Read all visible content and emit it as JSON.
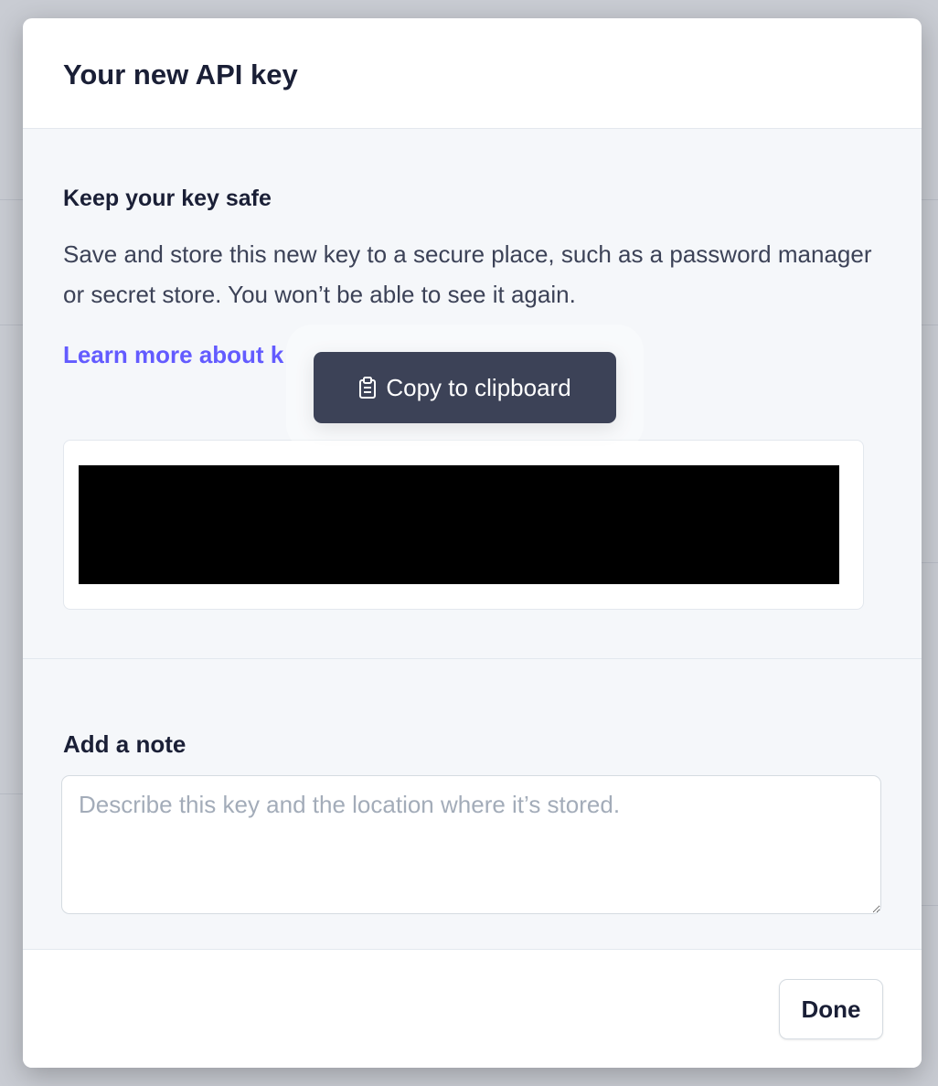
{
  "modal": {
    "title": "Your new API key"
  },
  "key_section": {
    "heading": "Keep your key safe",
    "description": "Save and store this new key to a secure place, such as a password manager or secret store. You won’t be able to see it again.",
    "learn_more_link": "Learn more about k",
    "key_value": "",
    "key_redacted": true
  },
  "tooltip": {
    "label": "Copy to clipboard",
    "icon": "clipboard-icon"
  },
  "note_section": {
    "label": "Add a note",
    "placeholder": "Describe this key and the location where it’s stored.",
    "value": ""
  },
  "footer": {
    "done_label": "Done"
  },
  "colors": {
    "accent": "#635bff",
    "tooltip_bg": "#3c4257",
    "body_bg": "#f5f7fa",
    "overlay": "#c9ccd3"
  }
}
